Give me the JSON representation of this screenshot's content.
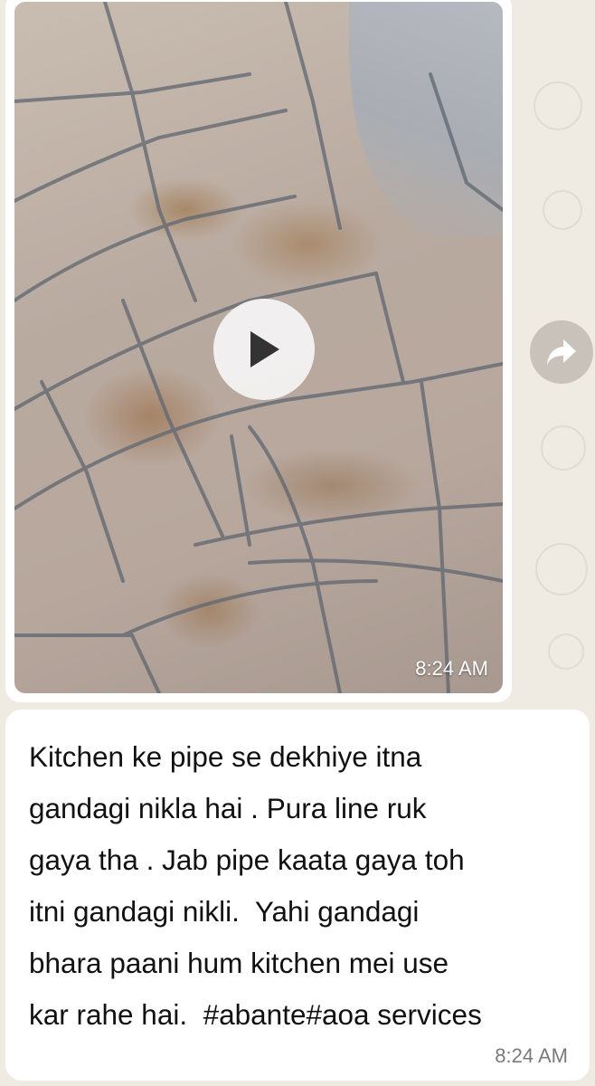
{
  "colors": {
    "chat_background": "#efeae2",
    "bubble_background": "#ffffff",
    "text": "#111111",
    "timestamp": "#7a7a7a"
  },
  "video_message": {
    "timestamp": "8:24 AM",
    "play_icon": "play-icon",
    "forward_icon": "forward-icon"
  },
  "text_message": {
    "lines": [
      "Kitchen ke pipe se dekhiye itna",
      "gandagi nikla hai . Pura line ruk",
      "gaya tha . Jab pipe kaata gaya toh",
      "itni gandagi nikli.  Yahi gandagi",
      "bhara paani hum kitchen mei use",
      "kar rahe hai.  #abante#aoa services"
    ],
    "timestamp": "8:24 AM"
  }
}
